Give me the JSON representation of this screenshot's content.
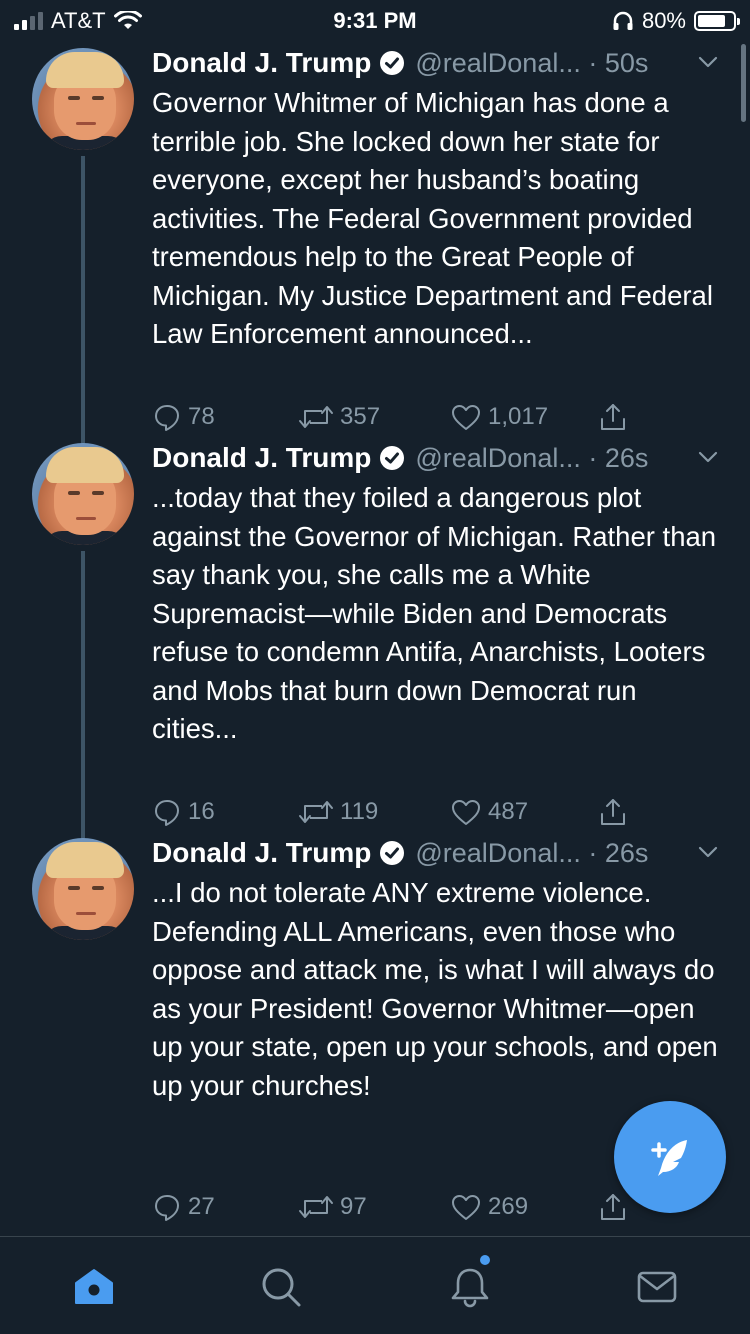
{
  "status_bar": {
    "carrier": "AT&T",
    "time": "9:31 PM",
    "battery_percent": "80%",
    "battery_level": 0.8,
    "signal_bars": 2
  },
  "author": {
    "name": "Donald J. Trump",
    "handle": "@realDonal..."
  },
  "tweets": [
    {
      "time": "50s",
      "text": "Governor Whitmer of Michigan has done a terrible job. She locked down her state for everyone, except her husband’s boating activities. The Federal Government provided tremendous help to the Great People of Michigan. My Justice Department and Federal Law Enforcement announced...",
      "replies": "78",
      "retweets": "357",
      "likes": "1,017"
    },
    {
      "time": "26s",
      "text": "...today that they foiled a dangerous plot against the Governor of Michigan. Rather than say thank you, she calls me a White Supremacist—while Biden and Democrats refuse to condemn Antifa, Anarchists, Looters and Mobs that burn down Democrat run cities...",
      "replies": "16",
      "retweets": "119",
      "likes": "487"
    },
    {
      "time": "26s",
      "text": "...I do not tolerate ANY extreme violence. Defending ALL Americans, even those who oppose and attack me, is what I will always do as your President! Governor Whitmer—open up your state, open up your schools, and open up your churches!",
      "replies": "27",
      "retweets": "97",
      "likes": "269"
    }
  ],
  "icons": {
    "reply": "reply-icon",
    "retweet": "retweet-icon",
    "like": "heart-icon",
    "share": "share-icon",
    "compose": "compose-tweet-icon",
    "tabs": [
      "home-icon",
      "search-icon",
      "notifications-icon",
      "messages-icon"
    ]
  },
  "colors": {
    "background": "#15202b",
    "secondary_text": "#8899a6",
    "accent": "#4a9cf0",
    "divider": "#38444d"
  }
}
